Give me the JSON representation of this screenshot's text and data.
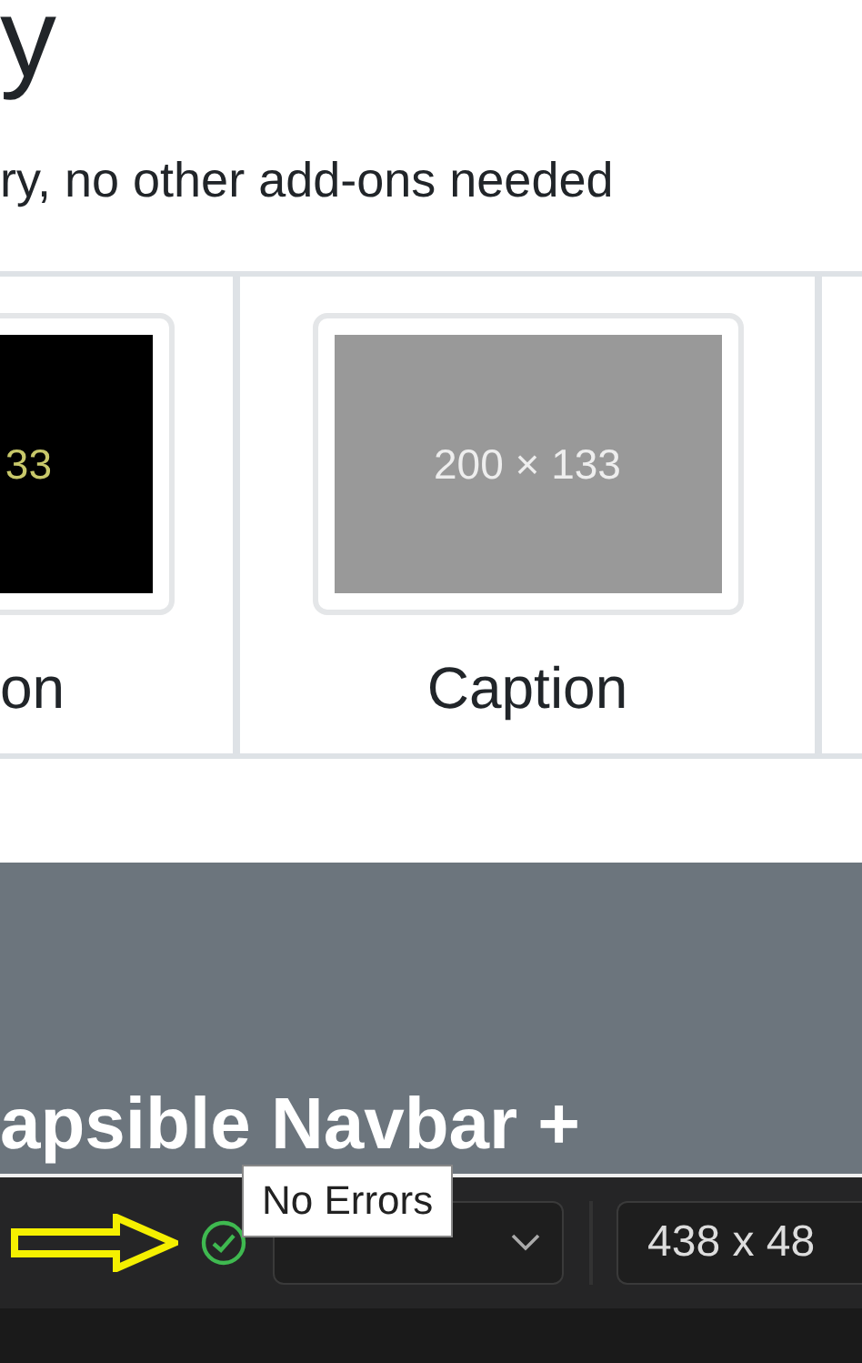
{
  "page": {
    "heading": "y",
    "lead": "ry, no other add-ons needed"
  },
  "gallery": [
    {
      "kind": "dark",
      "placeholder": "33",
      "caption": "on"
    },
    {
      "kind": "gray",
      "placeholder": "200 × 133",
      "caption": "Caption"
    }
  ],
  "jumbotron": {
    "heading": "apsible Navbar +"
  },
  "toolbar": {
    "status_tooltip": "No Errors",
    "size": "438 x 48"
  }
}
